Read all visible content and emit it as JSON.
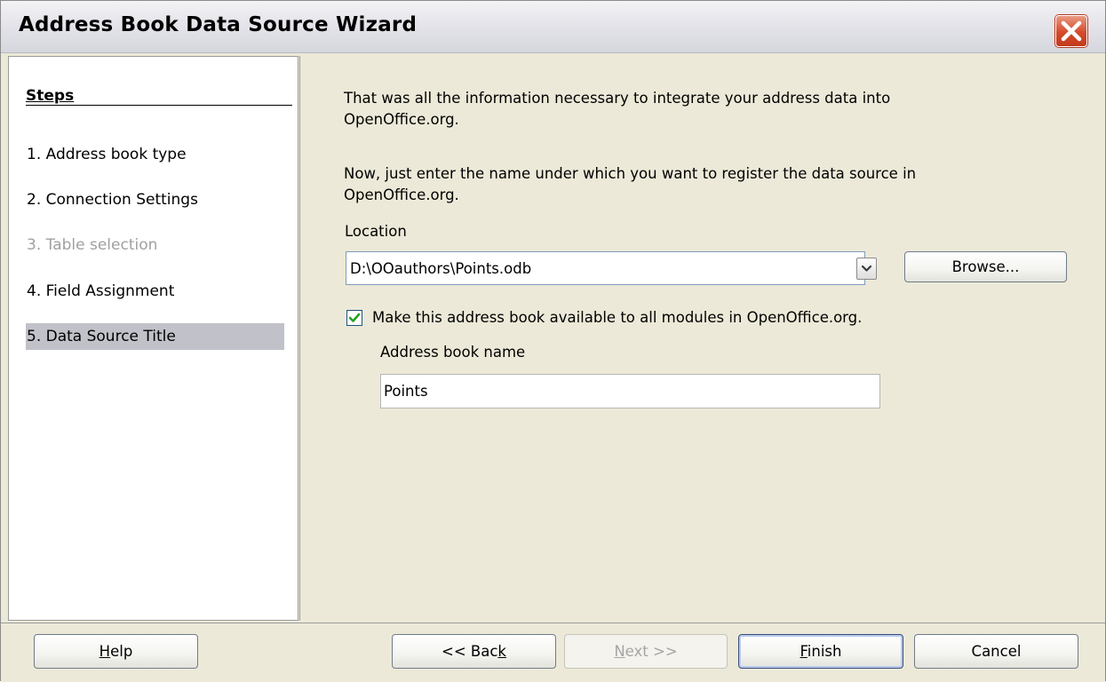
{
  "window": {
    "title": "Address Book Data Source Wizard",
    "close_icon": "close-icon",
    "accent_color": "#d54a2b"
  },
  "steps": {
    "header": "Steps",
    "items": [
      {
        "label": "1. Address book type",
        "state": "normal"
      },
      {
        "label": "2. Connection Settings",
        "state": "normal"
      },
      {
        "label": "3. Table selection",
        "state": "disabled"
      },
      {
        "label": "4. Field Assignment",
        "state": "normal"
      },
      {
        "label": "5. Data Source Title",
        "state": "active"
      }
    ]
  },
  "content": {
    "intro_line1": "That was all the information necessary to integrate your address data into",
    "intro_line2": "OpenOffice.org.",
    "instruction_line1": "Now, just enter the name under which you want to register the data source in",
    "instruction_line2": "OpenOffice.org.",
    "location_label": "Location",
    "location_value": "D:\\OOauthors\\Points.odb",
    "browse_label": "Browse...",
    "checkbox_label": "Make this address book available to all modules in OpenOffice.org.",
    "checkbox_checked": true,
    "address_book_name_label": "Address book name",
    "address_book_name_value": "Points"
  },
  "footer": {
    "help": {
      "pre": "",
      "mnemonic": "H",
      "post": "elp"
    },
    "back": {
      "pre": "<< Bac",
      "mnemonic": "k",
      "post": ""
    },
    "next": {
      "pre": "",
      "mnemonic": "N",
      "post": "ext >>",
      "enabled": false
    },
    "finish": {
      "pre": "",
      "mnemonic": "F",
      "post": "inish"
    },
    "cancel": {
      "label": "Cancel"
    }
  }
}
